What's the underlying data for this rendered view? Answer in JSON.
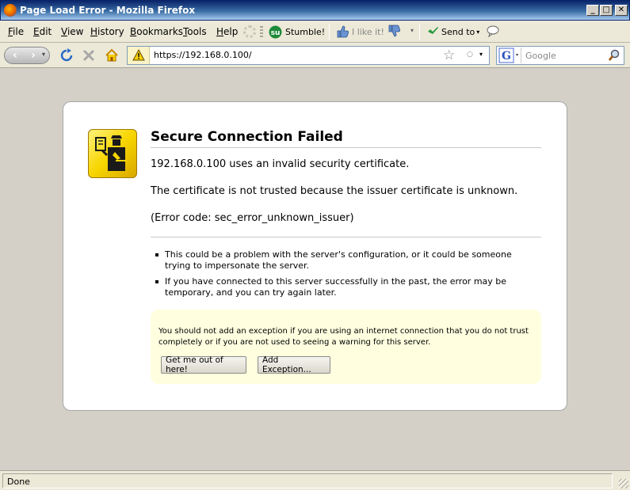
{
  "window": {
    "title": "Page Load Error - Mozilla Firefox",
    "minimize_glyph": "_",
    "maximize_glyph": "□",
    "close_glyph": "✕"
  },
  "menu": {
    "items": [
      {
        "label_u": "F",
        "label_rest": "ile"
      },
      {
        "label_u": "E",
        "label_rest": "dit"
      },
      {
        "label_u": "V",
        "label_rest": "iew"
      },
      {
        "label_u": "H",
        "label_rest": "istory"
      },
      {
        "label_u": "B",
        "label_rest": "ookmarks"
      },
      {
        "label_u": "T",
        "label_rest": "ools"
      },
      {
        "label_u": "H",
        "label_rest": "elp"
      }
    ],
    "stumble_label": "Stumble!",
    "ilike_label": "I like it!",
    "sendto_label": "Send to"
  },
  "nav": {
    "url": "https://192.168.0.100/",
    "search_placeholder": "Google"
  },
  "error": {
    "title": "Secure Connection Failed",
    "line1": "192.168.0.100 uses an invalid security certificate.",
    "line2": "The certificate is not trusted because the issuer certificate is unknown.",
    "line3": "(Error code: sec_error_unknown_issuer)",
    "bullets": [
      "This could be a problem with the server's configuration, or it could be someone trying to impersonate the server.",
      "If you have connected to this server successfully in the past, the error may be temporary, and you can try again later."
    ],
    "warning_text": "You should not add an exception if you are using an internet connection that you do not trust completely or if you are not used to seeing a warning for this server.",
    "btn_get_out": "Get me out of here!",
    "btn_add_exception": "Add Exception..."
  },
  "status": {
    "text": "Done"
  },
  "colors": {
    "titlebar": "#0a246a",
    "warning_bg": "#ffffe0",
    "icon_yellow": "#f7d500"
  }
}
